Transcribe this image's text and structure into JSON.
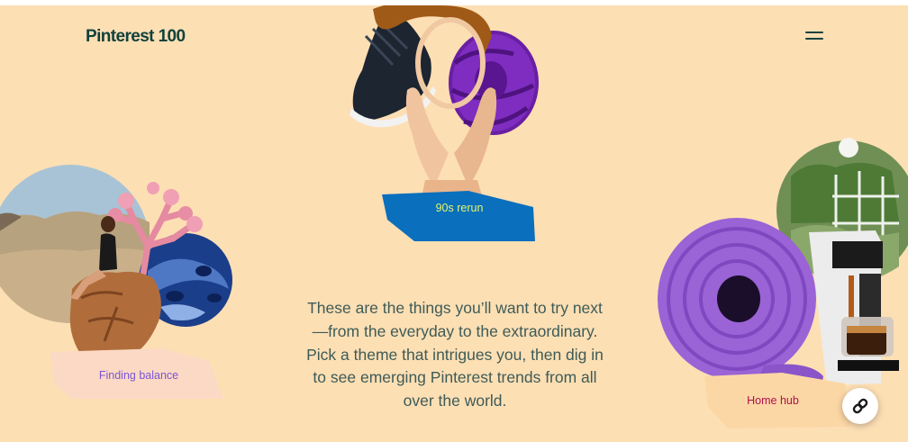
{
  "header": {
    "logo": "Pinterest 100",
    "menu_icon": "hamburger-menu-icon"
  },
  "themes": [
    {
      "label": "90s rerun",
      "label_color": "#e6f56a",
      "tag_color": "#0a6fbd"
    },
    {
      "label": "Finding balance",
      "label_color": "#7b55d6",
      "tag_color": "#fcd9c4"
    },
    {
      "label": "Home hub",
      "label_color": "#b0104a",
      "tag_color": "#fcd7a6"
    }
  ],
  "intro": {
    "text": "These are the things you’ll want to try next—from the everyday to the extraordinary. Pick a theme that intrigues you, then dig in to see emerging Pinterest trends from all over the world."
  },
  "fab": {
    "icon": "link-icon"
  },
  "colors": {
    "background": "#fddfb4",
    "logo": "#10423d",
    "body_text": "#3e5b57"
  }
}
